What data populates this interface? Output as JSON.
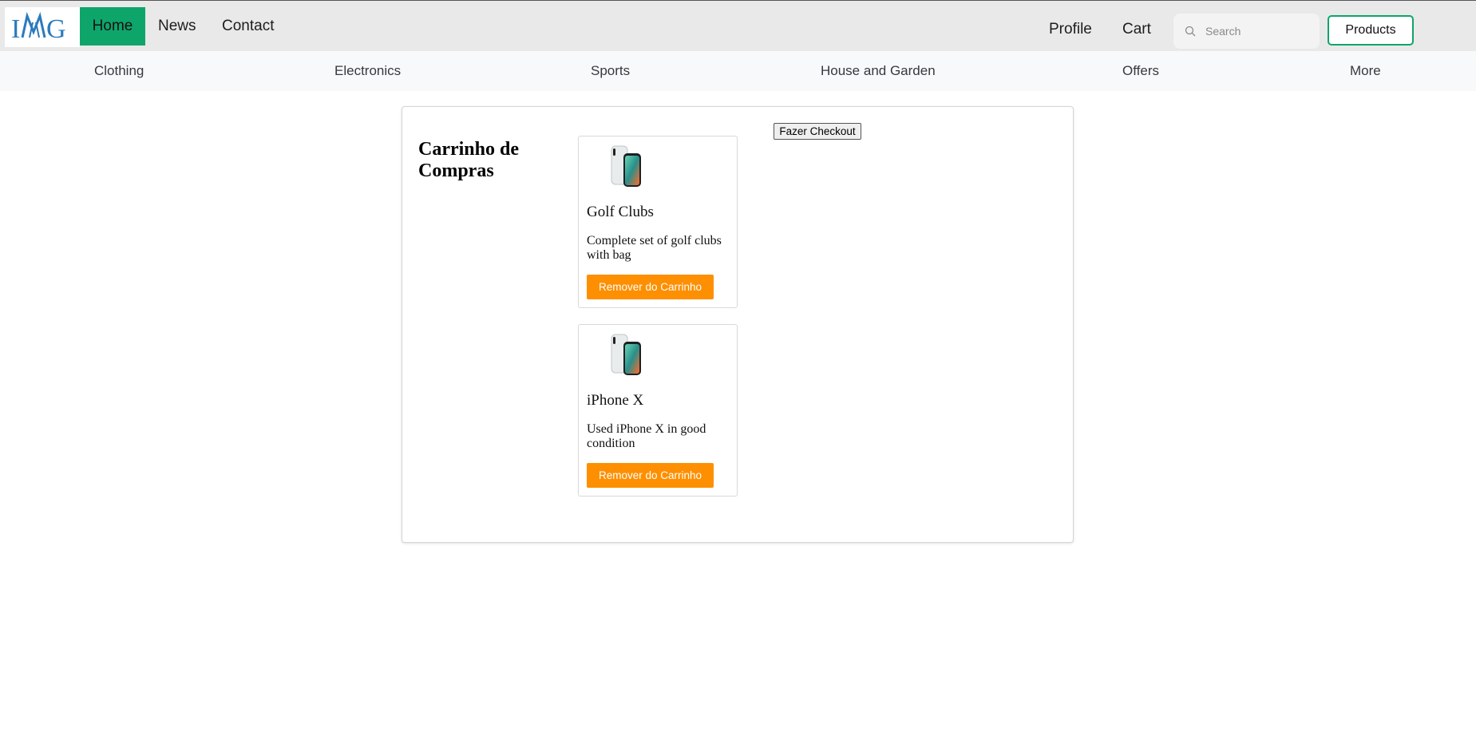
{
  "navbar": {
    "logo_text": "IMG",
    "links": {
      "home": "Home",
      "news": "News",
      "contact": "Contact"
    },
    "right_links": {
      "profile": "Profile",
      "cart": "Cart"
    },
    "search": {
      "placeholder": "Search",
      "value": ""
    },
    "products_button": "Products",
    "accent_color": "#0ea56b"
  },
  "categories": [
    "Clothing",
    "Electronics",
    "Sports",
    "House and Garden",
    "Offers",
    "More"
  ],
  "cart": {
    "title": "Carrinho de Compras",
    "checkout_button": "Fazer Checkout",
    "items": [
      {
        "name": "Golf Clubs",
        "description": "Complete set of golf clubs with bag",
        "remove_label": "Remover do Carrinho",
        "image": "iphone-x-image"
      },
      {
        "name": "iPhone X",
        "description": "Used iPhone X in good condition",
        "remove_label": "Remover do Carrinho",
        "image": "iphone-x-image"
      }
    ],
    "remove_color": "#fd8f00"
  }
}
